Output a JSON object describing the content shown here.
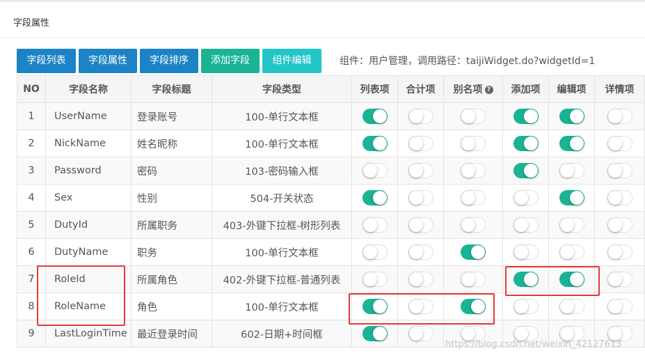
{
  "panel": {
    "title": "字段属性"
  },
  "toolbar": {
    "buttons": [
      {
        "label": "字段列表",
        "color": "#1c84c6"
      },
      {
        "label": "字段属性",
        "color": "#1c84c6"
      },
      {
        "label": "字段排序",
        "color": "#1c84c6"
      },
      {
        "label": "添加字段",
        "color": "#1ab394"
      },
      {
        "label": "组件编辑",
        "color": "#23c6c8"
      }
    ],
    "info": "组件：用户管理，调用路径：taijiWidget.do?widgetId=1"
  },
  "table": {
    "headers": [
      "NO",
      "字段名称",
      "字段标题",
      "字段类型",
      "列表项",
      "合计项",
      "别名项",
      "添加项",
      "编辑项",
      "详情项"
    ],
    "rows": [
      {
        "no": "1",
        "name": "UserName",
        "title": "登录账号",
        "type": "100-单行文本框",
        "toggles": [
          true,
          false,
          false,
          true,
          true,
          false
        ]
      },
      {
        "no": "2",
        "name": "NickName",
        "title": "姓名昵称",
        "type": "100-单行文本框",
        "toggles": [
          true,
          false,
          false,
          true,
          true,
          false
        ]
      },
      {
        "no": "3",
        "name": "Password",
        "title": "密码",
        "type": "103-密码输入框",
        "toggles": [
          false,
          false,
          false,
          true,
          false,
          false
        ]
      },
      {
        "no": "4",
        "name": "Sex",
        "title": "性别",
        "type": "504-开关状态",
        "toggles": [
          true,
          false,
          false,
          false,
          true,
          false
        ]
      },
      {
        "no": "5",
        "name": "DutyId",
        "title": "所属职务",
        "type": "403-外键下拉框-树形列表",
        "toggles": [
          false,
          false,
          false,
          false,
          false,
          false
        ]
      },
      {
        "no": "6",
        "name": "DutyName",
        "title": "职务",
        "type": "100-单行文本框",
        "toggles": [
          false,
          false,
          true,
          false,
          false,
          false
        ]
      },
      {
        "no": "7",
        "name": "RoleId",
        "title": "所属角色",
        "type": "402-外键下拉框-普通列表",
        "toggles": [
          false,
          false,
          false,
          true,
          true,
          false
        ]
      },
      {
        "no": "8",
        "name": "RoleName",
        "title": "角色",
        "type": "100-单行文本框",
        "toggles": [
          true,
          false,
          true,
          false,
          false,
          false
        ]
      },
      {
        "no": "9",
        "name": "LastLoginTime",
        "title": "最近登录时间",
        "type": "602-日期+时间框",
        "toggles": [
          true,
          false,
          false,
          false,
          false,
          false
        ]
      }
    ]
  },
  "watermark": "https://blog.csdn.net/weixin_42127613",
  "colors": {
    "toggle_on": "#1ab394",
    "highlight": "#e53935"
  }
}
